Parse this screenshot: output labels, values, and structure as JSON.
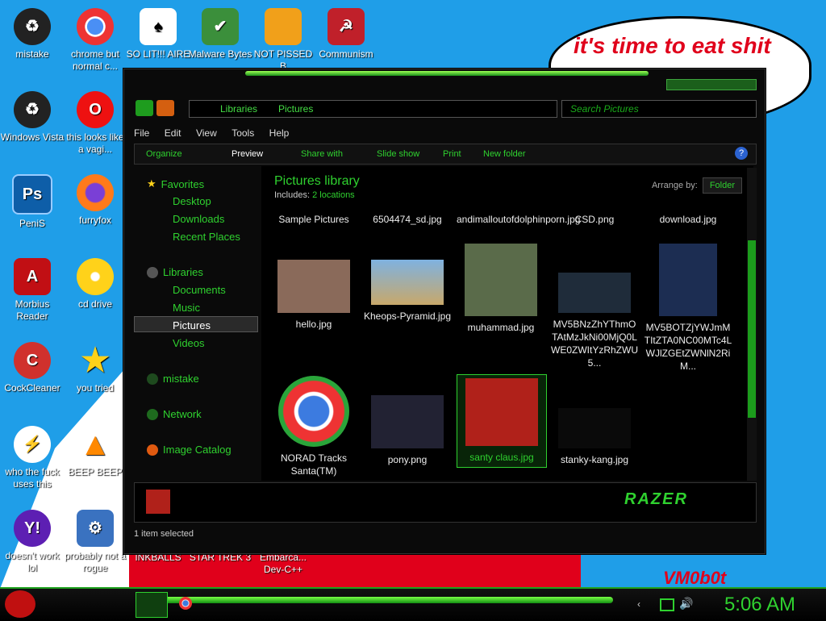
{
  "desktop": {
    "icons": [
      {
        "label": "mistake"
      },
      {
        "label": "chrome but normal c..."
      },
      {
        "label": "SO LIT!!! AIRE"
      },
      {
        "label": "Malware Bytes"
      },
      {
        "label": "NOT PISSED B"
      },
      {
        "label": "Communism"
      },
      {
        "label": "Windows Vista"
      },
      {
        "label": "this looks like a vagi..."
      },
      {
        "label": "PeniS"
      },
      {
        "label": "furryfox"
      },
      {
        "label": "Morbius Reader"
      },
      {
        "label": "cd drive"
      },
      {
        "label": "CockCleaner"
      },
      {
        "label": "you tried"
      },
      {
        "label": "who the fuck uses this"
      },
      {
        "label": "BEEP BEEP"
      },
      {
        "label": "doesn't work lol"
      },
      {
        "label": "probably not a rogue"
      },
      {
        "label": "INKBALLS"
      },
      {
        "label": "STAR TREK 3"
      },
      {
        "label": "Embarca... Dev-C++"
      }
    ],
    "bubble_text": "it's time to eat shit",
    "bottom_text": "VM0b0t"
  },
  "explorer": {
    "breadcrumb": [
      "Libraries",
      "Pictures"
    ],
    "search_placeholder": "Search Pictures",
    "menu": [
      "File",
      "Edit",
      "View",
      "Tools",
      "Help"
    ],
    "commands": [
      "Organize",
      "Preview",
      "Share with",
      "Slide show",
      "Print",
      "New folder"
    ],
    "nav": {
      "favorites": "Favorites",
      "desktop": "Desktop",
      "downloads": "Downloads",
      "recent": "Recent Places",
      "libraries": "Libraries",
      "documents": "Documents",
      "music": "Music",
      "pictures": "Pictures",
      "videos": "Videos",
      "mistake": "mistake",
      "network": "Network",
      "image_catalog": "Image Catalog"
    },
    "library_title": "Pictures library",
    "includes_label": "Includes:",
    "includes_value": "2 locations",
    "arrange_label": "Arrange by:",
    "arrange_value": "Folder",
    "files": [
      {
        "name": "Sample Pictures"
      },
      {
        "name": "6504474_sd.jpg"
      },
      {
        "name": "andimalloutofdolphinporn.jpg"
      },
      {
        "name": "CSD.png"
      },
      {
        "name": "download.jpg"
      },
      {
        "name": "hello.jpg"
      },
      {
        "name": "Kheops-Pyramid.jpg"
      },
      {
        "name": "muhammad.jpg"
      },
      {
        "name": "MV5BNzZhYThmOTAtMzJkNi00MjQ0LWE0ZWItYzRhZWU5..."
      },
      {
        "name": "MV5BOTZjYWJmMTItZTA0NC00MTc4LWJlZGEtZWNlN2RiM..."
      },
      {
        "name": "NORAD Tracks Santa(TM)"
      },
      {
        "name": "pony.png"
      },
      {
        "name": "santy claus.jpg"
      },
      {
        "name": "stanky-kang.jpg"
      }
    ],
    "status": "1 item selected",
    "brand": "RAZER"
  },
  "taskbar": {
    "clock": "5:06 AM"
  },
  "colors": {
    "accent": "#2fd12f",
    "desktop": "#1f9ee8",
    "bubble_text": "#e0001b"
  }
}
